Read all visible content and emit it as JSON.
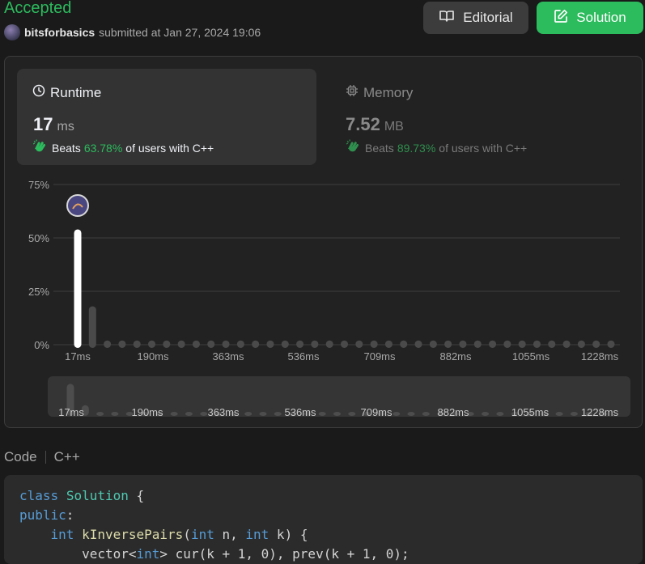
{
  "header": {
    "status": "Accepted",
    "username": "bitsforbasics",
    "submitted_text": "submitted at Jan 27, 2024 19:06"
  },
  "buttons": {
    "editorial": "Editorial",
    "solution": "Solution",
    "editorial_icon": "book-icon",
    "solution_icon": "edit-icon"
  },
  "runtime": {
    "title": "Runtime",
    "value": "17",
    "unit": "ms",
    "beats_label": "Beats",
    "beats_pct": "63.78%",
    "beats_suffix": "of users with C++",
    "icon": "clock-icon"
  },
  "memory": {
    "title": "Memory",
    "value": "7.52",
    "unit": "MB",
    "beats_label": "Beats",
    "beats_pct": "89.73%",
    "beats_suffix": "of users with C++",
    "icon": "chip-icon"
  },
  "chart_data": {
    "type": "bar",
    "y_ticks": [
      "75%",
      "50%",
      "25%",
      "0%"
    ],
    "ylim": [
      0,
      75
    ],
    "x_ticks": [
      "17ms",
      "190ms",
      "363ms",
      "536ms",
      "709ms",
      "882ms",
      "1055ms",
      "1228ms"
    ],
    "values": [
      54,
      18,
      2,
      2,
      2,
      2,
      2,
      2,
      2,
      2,
      2,
      2,
      2,
      2,
      2,
      2,
      2,
      2,
      2,
      2,
      2,
      2,
      2,
      2,
      2,
      2,
      2,
      2,
      2,
      2,
      2,
      2,
      2,
      2,
      2,
      2,
      2
    ],
    "highlight_index": 0,
    "grid": true
  },
  "overview_data": {
    "x_ticks": [
      "17ms",
      "190ms",
      "363ms",
      "536ms",
      "709ms",
      "882ms",
      "1055ms",
      "1228ms"
    ]
  },
  "code": {
    "label": "Code",
    "language": "C++"
  },
  "colors": {
    "accent": "#2cbb5d",
    "bar": "#4a4a4a",
    "bar_highlight": "#ffffff"
  }
}
